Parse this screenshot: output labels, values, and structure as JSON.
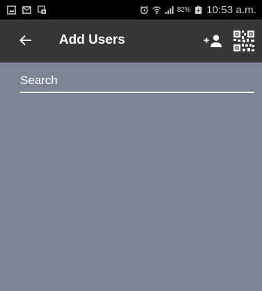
{
  "status_bar": {
    "battery_percent": "82%",
    "time": "10:53 a.m.",
    "icons": [
      "image-notification-icon",
      "mail-notification-icon",
      "screenshot-notification-icon",
      "alarm-icon",
      "wifi-icon",
      "signal-icon",
      "battery-icon"
    ]
  },
  "app_bar": {
    "title": "Add Users",
    "back_icon": "arrow-back-icon",
    "actions": [
      "person-add-icon",
      "qr-code-icon"
    ]
  },
  "search": {
    "placeholder": "Search",
    "value": ""
  },
  "colors": {
    "status_bar_bg": "#000000",
    "app_bar_bg": "#373737",
    "content_bg": "#7d8594",
    "text": "#ffffff"
  }
}
